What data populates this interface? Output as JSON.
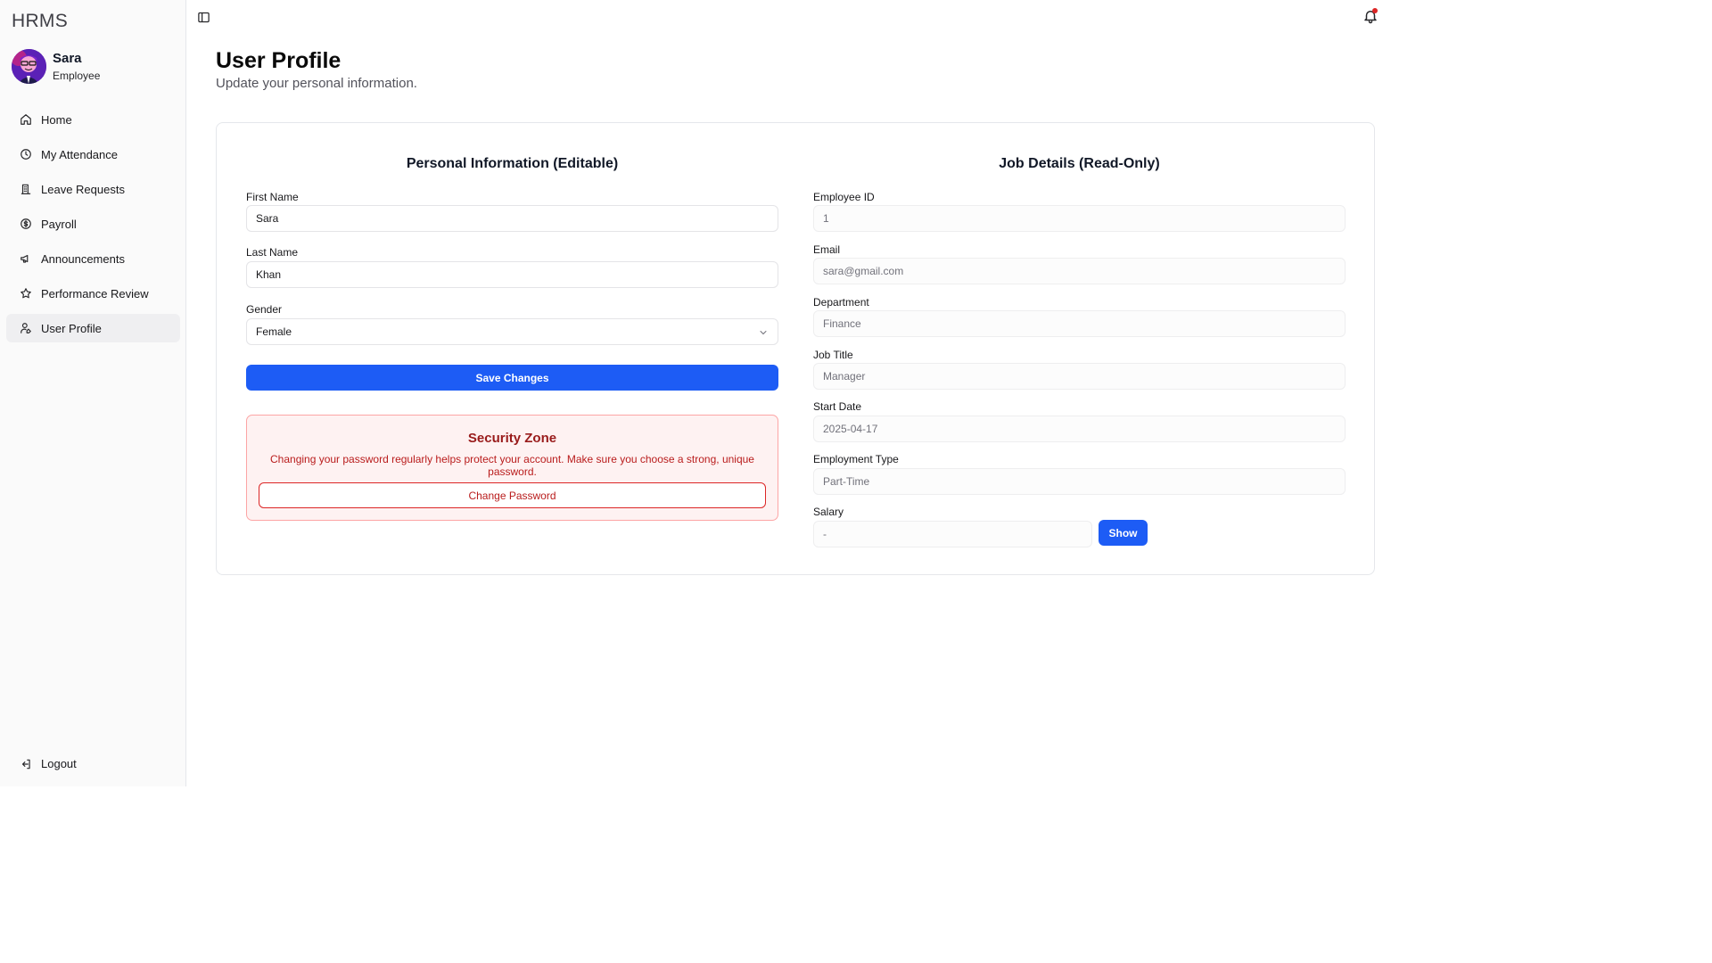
{
  "app": {
    "brand": "HRMS"
  },
  "user": {
    "name": "Sara",
    "role": "Employee"
  },
  "sidebar": {
    "items": [
      {
        "label": "Home",
        "icon": "home-icon"
      },
      {
        "label": "My Attendance",
        "icon": "clock-icon"
      },
      {
        "label": "Leave Requests",
        "icon": "building-icon"
      },
      {
        "label": "Payroll",
        "icon": "dollar-circle-icon"
      },
      {
        "label": "Announcements",
        "icon": "megaphone-icon"
      },
      {
        "label": "Performance Review",
        "icon": "star-icon"
      },
      {
        "label": "User Profile",
        "icon": "user-pen-icon",
        "active": true
      }
    ],
    "logout": "Logout"
  },
  "topbar": {
    "toggle_icon": "sidebar-toggle-icon",
    "bell_icon": "bell-icon",
    "has_notification": true
  },
  "header": {
    "title": "User Profile",
    "subtitle": "Update your personal information."
  },
  "personal": {
    "title": "Personal Information (Editable)",
    "first_name_label": "First Name",
    "first_name": "Sara",
    "last_name_label": "Last Name",
    "last_name": "Khan",
    "gender_label": "Gender",
    "gender": "Female",
    "save_label": "Save Changes"
  },
  "security": {
    "title": "Security Zone",
    "text": "Changing your password regularly helps protect your account. Make sure you choose a strong, unique password.",
    "button": "Change Password"
  },
  "job": {
    "title": "Job Details (Read-Only)",
    "employee_id_label": "Employee ID",
    "employee_id": "1",
    "email_label": "Email",
    "email": "sara@gmail.com",
    "department_label": "Department",
    "department": "Finance",
    "job_title_label": "Job Title",
    "job_title": "Manager",
    "start_date_label": "Start Date",
    "start_date": "2025-04-17",
    "employment_type_label": "Employment Type",
    "employment_type": "Part-Time",
    "salary_label": "Salary",
    "salary": "-",
    "show_label": "Show"
  },
  "colors": {
    "primary": "#1d5cf5",
    "danger": "#b91c1c",
    "danger_bg": "#fef2f2",
    "notification": "#dc2626"
  }
}
